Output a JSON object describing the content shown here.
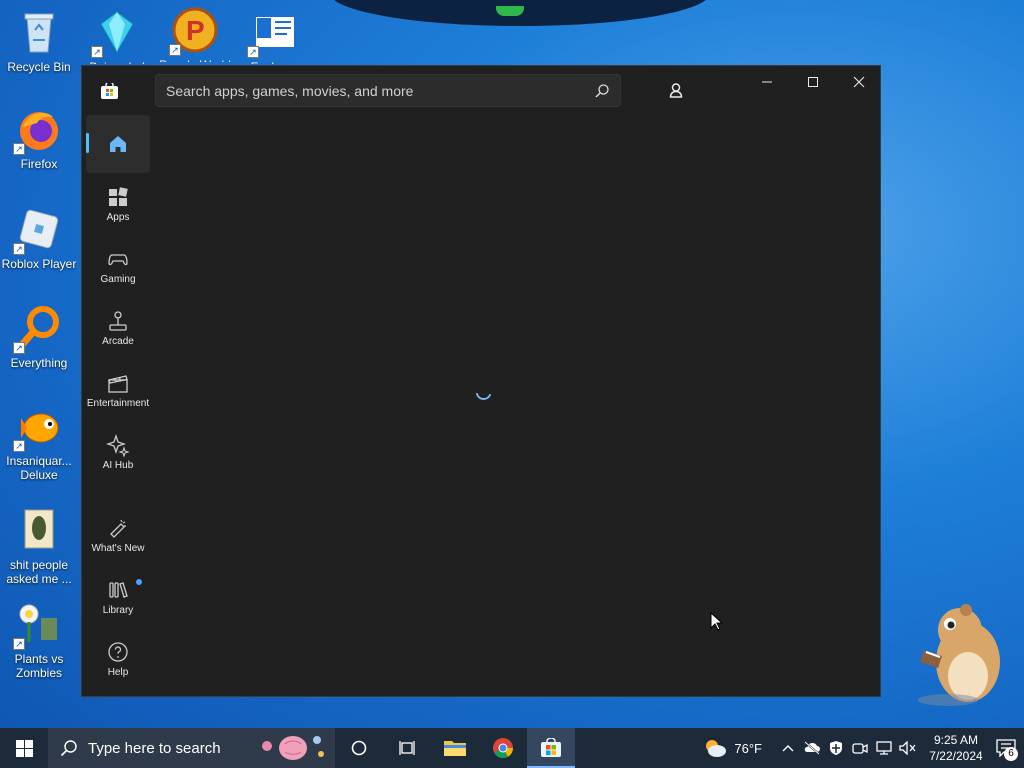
{
  "desktop": {
    "icons": [
      {
        "label": "Recycle Bin"
      },
      {
        "label": "Bejeweled"
      },
      {
        "label": "Peggle World"
      },
      {
        "label": "Explorer"
      },
      {
        "label": "Firefox"
      },
      {
        "label": "Roblox Player"
      },
      {
        "label": "Everything"
      },
      {
        "label": "Insaniquar... Deluxe"
      },
      {
        "label": "shit people asked me ..."
      },
      {
        "label": "Plants vs Zombies"
      }
    ]
  },
  "store": {
    "search_placeholder": "Search apps, games, movies, and more",
    "nav": [
      {
        "label": "",
        "icon": "home-icon"
      },
      {
        "label": "Apps",
        "icon": "apps-icon"
      },
      {
        "label": "Gaming",
        "icon": "gamepad-icon"
      },
      {
        "label": "Arcade",
        "icon": "joystick-icon"
      },
      {
        "label": "Entertainment",
        "icon": "clapperboard-icon"
      },
      {
        "label": "AI Hub",
        "icon": "sparkle-icon"
      },
      {
        "label": "What's New",
        "icon": "megaphone-icon"
      },
      {
        "label": "Library",
        "icon": "library-icon"
      },
      {
        "label": "Help",
        "icon": "help-icon"
      }
    ]
  },
  "taskbar": {
    "search_placeholder": "Type here to search",
    "weather_temp": "76°F",
    "clock_time": "9:25 AM",
    "clock_date": "7/22/2024",
    "notification_count": "6"
  },
  "colors": {
    "accent": "#4cc2ff",
    "window_bg": "#202020",
    "taskbar_bg": "#1d2a3a"
  }
}
